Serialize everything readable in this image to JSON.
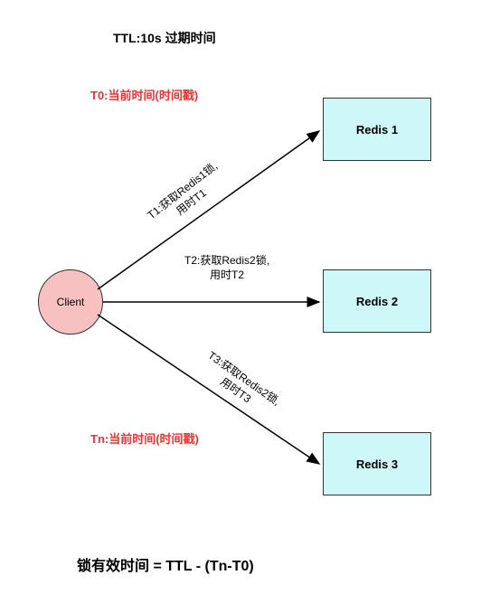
{
  "header": {
    "ttl": "TTL:10s   过期时间"
  },
  "timestamps": {
    "t0": "T0:当前时间(时间戳)",
    "tn": "Tn:当前时间(时间戳)"
  },
  "client": {
    "label": "Client"
  },
  "redis_nodes": [
    {
      "label": "Redis 1"
    },
    {
      "label": "Redis 2"
    },
    {
      "label": "Redis 3"
    }
  ],
  "arrow_labels": {
    "t1": "T1:获取Redis1锁,\n用时T1",
    "t2": "T2:获取Redis2锁,\n用时T2",
    "t3": "T3:获取Redis2锁,\n用时T3"
  },
  "formula": "锁有效时间 = TTL - (Tn-T0)",
  "colors": {
    "client_fill": "#f7c1c1",
    "redis_fill": "#cef7f7",
    "timestamp_text": "#ee3333"
  }
}
